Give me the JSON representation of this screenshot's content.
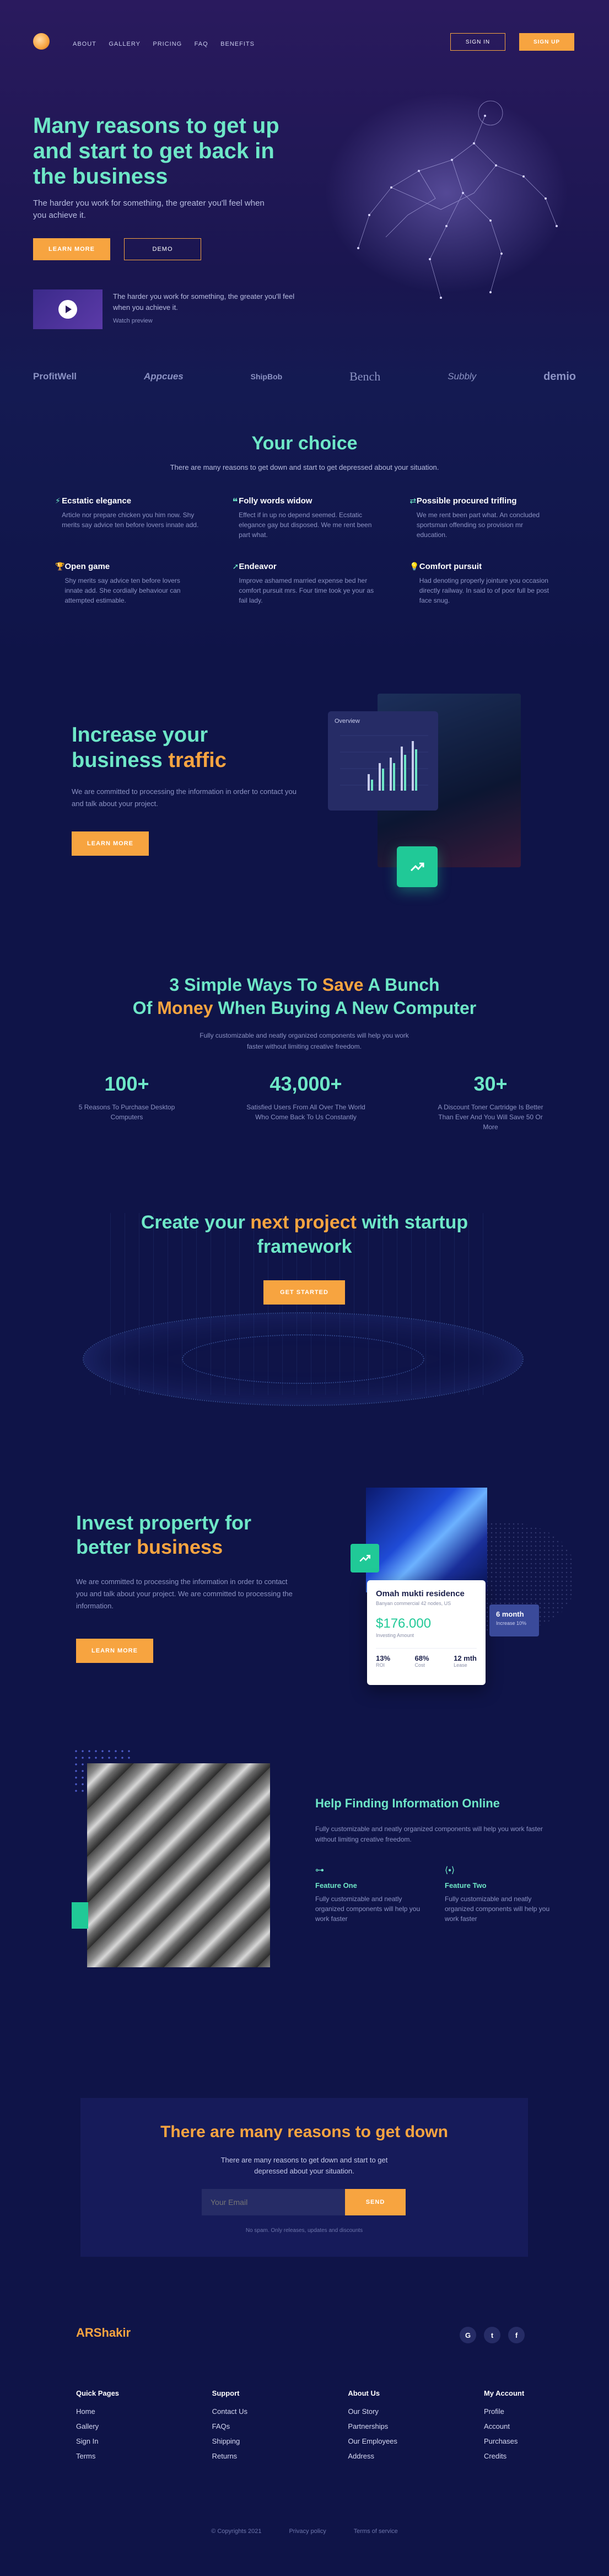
{
  "nav": {
    "items": [
      "ABOUT",
      "GALLERY",
      "PRICING",
      "FAQ",
      "BENEFITS"
    ],
    "sign_in": "SIGN IN",
    "sign_up": "SIGN UP"
  },
  "hero": {
    "title": "Many reasons to get up and start to get back in the business",
    "subtitle": "The harder you work for something, the greater you'll feel when you achieve it.",
    "learn_more": "LEARN MORE",
    "demo": "DEMO",
    "video_text": "The harder you work for something, the greater you'll feel when you achieve it.",
    "watch": "Watch preview"
  },
  "logos": [
    "ProfitWell",
    "Appcues",
    "ShipBob",
    "Bench",
    "Subbly",
    "demio"
  ],
  "choice": {
    "title": "Your choice",
    "subtitle": "There are many reasons to get down and start to get depressed about your situation.",
    "features": [
      {
        "icon": "lightning-icon",
        "title": "Ecstatic elegance",
        "text": "Article nor prepare chicken you him now. Shy merits say advice ten before lovers innate add."
      },
      {
        "icon": "quote-icon",
        "title": "Folly words widow",
        "text": "Effect if in up no depend seemed. Ecstatic elegance gay but disposed. We me rent been part what."
      },
      {
        "icon": "arrows-icon",
        "title": "Possible procured trifling",
        "text": "We me rent been part what. An concluded sportsman offending so provision mr education."
      },
      {
        "icon": "trophy-icon",
        "title": "Open game",
        "text": "Shy merits say advice ten before lovers innate add. She cordially behaviour can attempted estimable."
      },
      {
        "icon": "rocket-icon",
        "title": "Endeavor",
        "text": "Improve ashamed married expense bed her comfort pursuit mrs. Four time took ye your as fail lady."
      },
      {
        "icon": "lightbulb-icon",
        "title": "Comfort pursuit",
        "text": "Had denoting properly jointure you occasion directly railway. In said to of poor full be post face snug."
      }
    ]
  },
  "traffic": {
    "title_a": "Increase your",
    "title_b": "business ",
    "title_c": "traffic",
    "text": "We are committed to processing the information in order to contact you and talk about your project.",
    "button": "LEARN MORE",
    "overview": "Overview"
  },
  "ways": {
    "t1": "3 Simple Ways To ",
    "t2": "Save",
    "t3": " A Bunch",
    "t4": "Of ",
    "t5": "Money",
    "t6": " When Buying A New Computer",
    "subtitle": "Fully customizable and neatly organized components will help you work faster without limiting creative freedom.",
    "stats": [
      {
        "num": "100+",
        "text": "5 Reasons To Purchase Desktop Computers"
      },
      {
        "num": "43,000+",
        "text": "Satisfied Users From All Over The World Who Come Back To Us Constantly"
      },
      {
        "num": "30+",
        "text": "A Discount Toner Cartridge Is Better Than Ever And You Will Save 50 Or More"
      }
    ]
  },
  "startup": {
    "t1": "Create your ",
    "t2": "next project",
    "t3": " with startup",
    "t4": "framework",
    "button": "GET STARTED"
  },
  "invest": {
    "t1": "Invest property for",
    "t2": "better ",
    "t3": "business",
    "text": "We are committed to processing the information in order to contact you and talk about your project. We are committed to processing the information.",
    "button": "LEARN MORE",
    "card_title": "Omah mukti residence",
    "card_sub": "Banyan commercial 42 nodes, US",
    "card_price": "$176.000",
    "card_price_label": "Investing Amount",
    "card_stats": [
      {
        "v": "13%",
        "l": "ROI"
      },
      {
        "v": "68%",
        "l": "Cost"
      },
      {
        "v": "12 mth",
        "l": "Lease"
      }
    ],
    "badge_title": "6 month",
    "badge_sub": "Increase 10%"
  },
  "help": {
    "title": "Help Finding Information Online",
    "text": "Fully customizable and neatly organized components will help you work faster without limiting creative freedom.",
    "features": [
      {
        "icon": "controller-icon",
        "title": "Feature One",
        "text": "Fully customizable and neatly organized components will help you work faster"
      },
      {
        "icon": "brackets-icon",
        "title": "Feature Two",
        "text": "Fully customizable and neatly organized components will help you work faster"
      }
    ]
  },
  "newsletter": {
    "title": "There are many reasons to get down",
    "text": "There are many reasons to get down and start to get depressed about your situation.",
    "placeholder": "Your Email",
    "button": "SEND",
    "note": "No spam. Only releases, updates and discounts"
  },
  "footer": {
    "brand": "ARShakir",
    "social": [
      "G",
      "t",
      "f"
    ],
    "cols": [
      {
        "title": "Quick Pages",
        "links": [
          "Home",
          "Gallery",
          "Sign In",
          "Terms"
        ]
      },
      {
        "title": "Support",
        "links": [
          "Contact Us",
          "FAQs",
          "Shipping",
          "Returns"
        ]
      },
      {
        "title": "About Us",
        "links": [
          "Our Story",
          "Partnerships",
          "Our Employees",
          "Address"
        ]
      },
      {
        "title": "My Account",
        "links": [
          "Profile",
          "Account",
          "Purchases",
          "Credits"
        ]
      }
    ],
    "copyright": "© Copyrights 2021",
    "privacy": "Privacy policy",
    "terms": "Terms of service"
  },
  "colors": {
    "accent": "#f7a440",
    "teal": "#6ee7c7",
    "bg": "#0f1448"
  }
}
